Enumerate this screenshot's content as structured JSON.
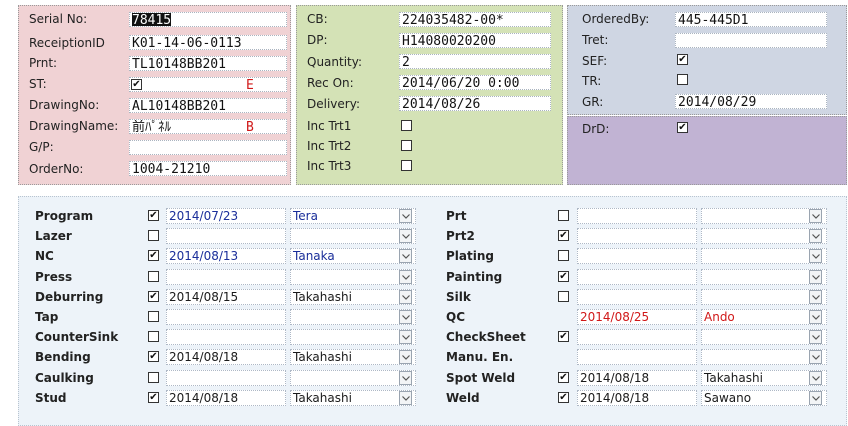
{
  "info": {
    "serial_no": {
      "label": "Serial No:",
      "value": "78415"
    },
    "receiption_id": {
      "label": "ReceiptionID",
      "value": "K01-14-06-0113"
    },
    "prnt": {
      "label": "Prnt:",
      "value": "TL10148BB201"
    },
    "st": {
      "label": "ST:",
      "checked": true,
      "mark": "E"
    },
    "drawing_no": {
      "label": "DrawingNo:",
      "value": "AL10148BB201"
    },
    "drawing_name": {
      "label": "DrawingName:",
      "value": "前ﾊﾟﾈﾙ",
      "mark": "B"
    },
    "gp": {
      "label": "G/P:",
      "value": ""
    },
    "order_no": {
      "label": "OrderNo:",
      "value": "1004-21210"
    }
  },
  "order": {
    "cb": {
      "label": "CB:",
      "value": "224035482-00*"
    },
    "dp": {
      "label": "DP:",
      "value": "H14080020200"
    },
    "quantity": {
      "label": "Quantity:",
      "value": "2"
    },
    "rec_on": {
      "label": "Rec On:",
      "value": "2014/06/20  0:00"
    },
    "delivery": {
      "label": "Delivery:",
      "value": "2014/08/26"
    },
    "inc_trt1": {
      "label": "Inc Trt1",
      "checked": false
    },
    "inc_trt2": {
      "label": "Inc Trt2",
      "checked": false
    },
    "inc_trt3": {
      "label": "Inc Trt3",
      "checked": false
    }
  },
  "status": {
    "ordered_by": {
      "label": "OrderedBy:",
      "value": "445-445D1"
    },
    "tret": {
      "label": "Tret:",
      "value": ""
    },
    "sef": {
      "label": "SEF:",
      "checked": true
    },
    "tr": {
      "label": "TR:",
      "checked": false
    },
    "gr": {
      "label": "GR:",
      "value": "2014/08/29"
    },
    "drd": {
      "label": "DrD:",
      "checked": true
    }
  },
  "processes_left": [
    {
      "name": "Program",
      "checked": true,
      "date": "2014/07/23",
      "person": "Tera",
      "style": "blue"
    },
    {
      "name": "Lazer",
      "checked": false,
      "date": "",
      "person": "",
      "style": ""
    },
    {
      "name": "NC",
      "checked": true,
      "date": "2014/08/13",
      "person": "Tanaka",
      "style": "blue"
    },
    {
      "name": "Press",
      "checked": false,
      "date": "",
      "person": "",
      "style": ""
    },
    {
      "name": "Deburring",
      "checked": true,
      "date": "2014/08/15",
      "person": "Takahashi",
      "style": ""
    },
    {
      "name": "Tap",
      "checked": false,
      "date": "",
      "person": "",
      "style": ""
    },
    {
      "name": "CounterSink",
      "checked": false,
      "date": "",
      "person": "",
      "style": ""
    },
    {
      "name": "Bending",
      "checked": true,
      "date": "2014/08/18",
      "person": "Takahashi",
      "style": ""
    },
    {
      "name": "Caulking",
      "checked": false,
      "date": "",
      "person": "",
      "style": ""
    },
    {
      "name": "Stud",
      "checked": true,
      "date": "2014/08/18",
      "person": "Takahashi",
      "style": ""
    }
  ],
  "processes_right": [
    {
      "name": "Prt",
      "checked": false,
      "has_check": true,
      "date": "",
      "person": "",
      "style": ""
    },
    {
      "name": "Prt2",
      "checked": true,
      "has_check": true,
      "date": "",
      "person": "",
      "style": ""
    },
    {
      "name": "Plating",
      "checked": false,
      "has_check": true,
      "date": "",
      "person": "",
      "style": ""
    },
    {
      "name": "Painting",
      "checked": true,
      "has_check": true,
      "date": "",
      "person": "",
      "style": ""
    },
    {
      "name": "Silk",
      "checked": false,
      "has_check": true,
      "date": "",
      "person": "",
      "style": ""
    },
    {
      "name": "QC",
      "checked": false,
      "has_check": false,
      "date": "2014/08/25",
      "person": "Ando",
      "style": "red"
    },
    {
      "name": "CheckSheet",
      "checked": true,
      "has_check": true,
      "date": "",
      "person": "",
      "style": ""
    },
    {
      "name": "Manu. En.",
      "checked": false,
      "has_check": false,
      "date": "",
      "person": "",
      "style": ""
    },
    {
      "name": "Spot Weld",
      "checked": true,
      "has_check": true,
      "date": "2014/08/18",
      "person": "Takahashi",
      "style": ""
    },
    {
      "name": "Weld",
      "checked": true,
      "has_check": true,
      "date": "2014/08/18",
      "person": "Sawano",
      "style": ""
    }
  ],
  "colors": {
    "pink": "#f0d2d4",
    "green": "#d4e2b6",
    "blue": "#cfd6e3",
    "purple": "#c1b3d3",
    "red_text": "#d01818",
    "blue_text": "#1a2e9a"
  }
}
